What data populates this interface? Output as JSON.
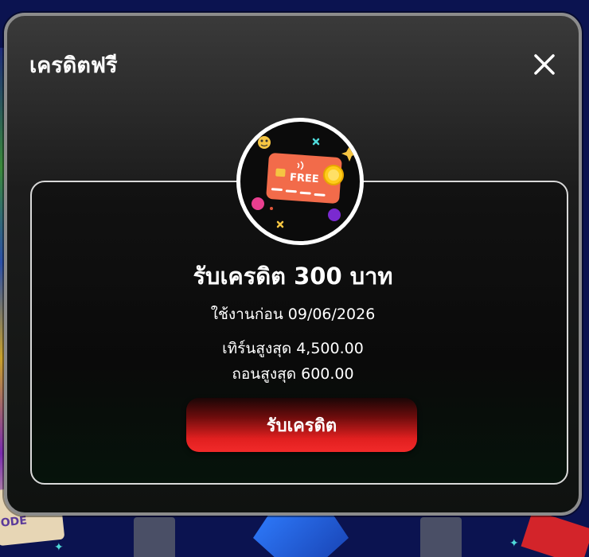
{
  "modal": {
    "title": "เครดิตฟรี",
    "close_icon": "close-icon"
  },
  "promo": {
    "icon": "free-credit-card-icon",
    "card_text": "FREE",
    "heading": "รับเครดิต 300 บาท",
    "expire_text": "ใช้งานก่อน 09/06/2026",
    "turnover_text": "เทิร์นสูงสุด 4,500.00",
    "withdraw_text": "ถอนสูงสุด 600.00",
    "claim_button_label": "รับเครดิต"
  },
  "background": {
    "ticket_text": "ODE"
  },
  "colors": {
    "accent_red": "#e01f1f",
    "card_orange": "#f26b4a",
    "coin_gold": "#ffcc1a"
  }
}
